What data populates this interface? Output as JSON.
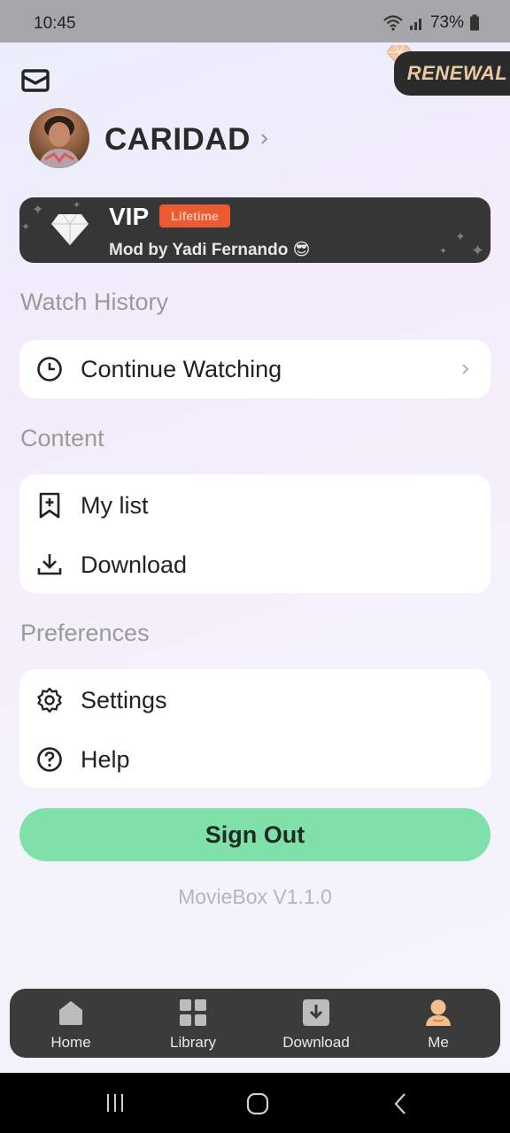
{
  "status_bar": {
    "time": "10:45",
    "battery": "73%"
  },
  "header": {
    "mail_icon": "mail-icon",
    "renewal_label": "RENEWAL",
    "username": "CARIDAD"
  },
  "vip": {
    "title": "VIP",
    "badge": "Lifetime",
    "subtitle": "Mod by Yadi Fernando 😎"
  },
  "sections": {
    "watch_history": {
      "label": "Watch History",
      "items": [
        {
          "label": "Continue Watching",
          "icon": "clock-icon"
        }
      ]
    },
    "content": {
      "label": "Content",
      "items": [
        {
          "label": "My list",
          "icon": "bookmark-add-icon"
        },
        {
          "label": "Download",
          "icon": "download-icon"
        }
      ]
    },
    "preferences": {
      "label": "Preferences",
      "items": [
        {
          "label": "Settings",
          "icon": "gear-icon"
        },
        {
          "label": "Help",
          "icon": "help-icon"
        }
      ]
    }
  },
  "sign_out_label": "Sign Out",
  "version": "MovieBox V1.1.0",
  "bottom_nav": [
    {
      "label": "Home",
      "icon": "home-icon"
    },
    {
      "label": "Library",
      "icon": "library-icon"
    },
    {
      "label": "Download",
      "icon": "download-icon"
    },
    {
      "label": "Me",
      "icon": "person-icon",
      "active": true
    }
  ],
  "colors": {
    "accent": "#7fe1a9",
    "card_dark": "#363636",
    "badge": "#ec5a34",
    "renewal_text": "#e9c9a2"
  }
}
